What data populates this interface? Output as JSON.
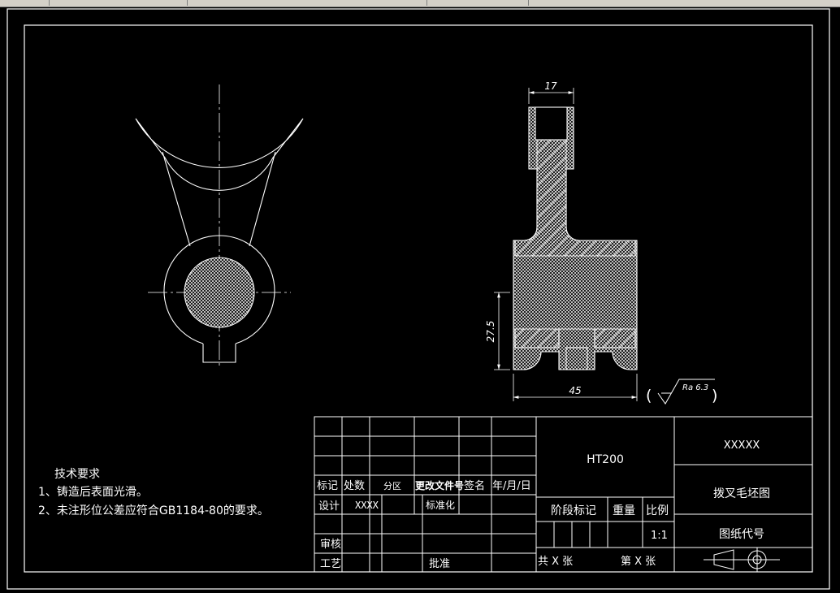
{
  "colors": {
    "background": "#000000",
    "line": "#ffffff",
    "toolbar": "#d4d0c8"
  },
  "dimensions": {
    "width_top": "17",
    "height_left": "27.5",
    "width_bottom": "45"
  },
  "roughness": {
    "open": "(",
    "value": "Ra 6.3",
    "close": ")"
  },
  "tech_req": {
    "title": "技术要求",
    "line1": "1、铸造后表面光滑。",
    "line2": "2、未注形位公差应符合GB1184-80的要求。"
  },
  "title_block": {
    "material": "HT200",
    "company": "XXXXX",
    "drawing_name": "拨叉毛坯图",
    "drawing_code": "图纸代号",
    "stage_mark": "阶段标记",
    "weight": "重量",
    "scale_label": "比例",
    "scale_value": "1:1",
    "sheets_total": "共 X 张",
    "sheet_no": "第 X 张",
    "rev_mark": "标记",
    "rev_count": "处数",
    "rev_zone": "分区",
    "rev_doc": "更改文件号",
    "rev_sign": "签名",
    "rev_date": "年/月/日",
    "design": "设计",
    "designer": "XXXX",
    "standard": "标准化",
    "review": "审核",
    "process": "工艺",
    "approve": "批准"
  }
}
